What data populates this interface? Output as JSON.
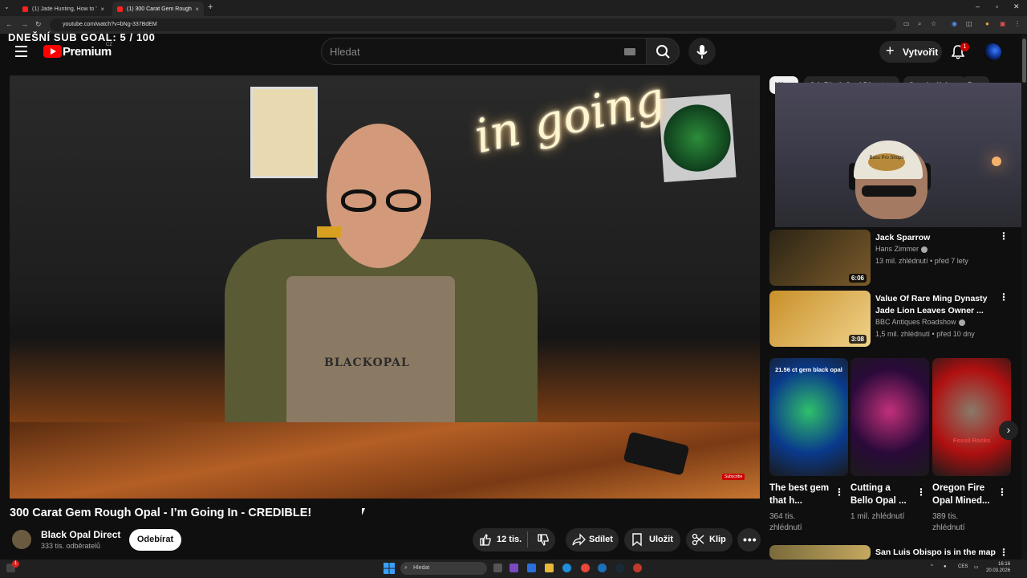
{
  "browser": {
    "tabs": [
      {
        "label": "(1) Jade Hunting, How to \"Ident",
        "active": false
      },
      {
        "label": "(1) 300 Carat Gem Rough Opal",
        "active": true
      }
    ],
    "url": "youtube.com/watch?v=bNg-337BdEM"
  },
  "overlay": {
    "sub_goal": "DNEŠNÍ SUB GOAL:  5 / 100"
  },
  "header": {
    "brand": "Premium",
    "country": "CZ",
    "search_placeholder": "Hledat",
    "create_label": "Vytvořit",
    "notification_count": "1"
  },
  "video": {
    "title": "300 Carat Gem Rough Opal - I’m Going In - CREDIBLE!",
    "neon_text": "in going",
    "apron_brand": "BLACKOPAL",
    "subscribe_watermark": "Subscribe",
    "channel": {
      "name": "Black Opal Direct",
      "subscribers": "333 tis. odběratelů"
    },
    "subscribe_label": "Odebírat",
    "actions": {
      "likes": "12 tis.",
      "share": "Sdílet",
      "save": "Uložit",
      "clip": "Klip"
    }
  },
  "webcam": {
    "hat_text": "Bass Pro Shops"
  },
  "chips": [
    "Vše",
    "Od: Black Opal Direct",
    "Související",
    "P"
  ],
  "related": [
    {
      "title": "Jack Sparrow",
      "channel": "Hans Zimmer",
      "meta": "13 mil. zhlédnutí • před 7 lety",
      "duration": "6:06",
      "thumb_colors": [
        "#2b2415",
        "#7a5a2a"
      ]
    },
    {
      "title": "Value Of Rare Ming Dynasty Jade Lion Leaves Owner ...",
      "channel": "BBC Antiques Roadshow",
      "meta": "1,5 mil. zhlédnutí • před 10 dny",
      "duration": "3:08",
      "thumb_colors": [
        "#c9902a",
        "#f0d28a"
      ]
    }
  ],
  "shorts": [
    {
      "overlay": "21.56 ct gem black opal",
      "title": "The best gem that h...",
      "views": "364 tis. zhlédnutí",
      "colors": [
        "#0a3a8c",
        "#2fc06a"
      ]
    },
    {
      "overlay": "",
      "title": "Cutting a Bello Opal ...",
      "views": "1 mil. zhlédnutí",
      "colors": [
        "#2a0a3a",
        "#c2307a"
      ]
    },
    {
      "overlay": "Fossil Rocks",
      "title": "Oregon Fire Opal Mined...",
      "views": "389 tis. zhlédnutí",
      "colors": [
        "#b01010",
        "#8a7a6a"
      ]
    }
  ],
  "next_related": {
    "title": "San Luis Obispo is in the map"
  },
  "taskbar": {
    "search_placeholder": "Hledat",
    "lang": "CES",
    "time": "16:16",
    "date": "20.03.2026",
    "notification_count": "1"
  }
}
